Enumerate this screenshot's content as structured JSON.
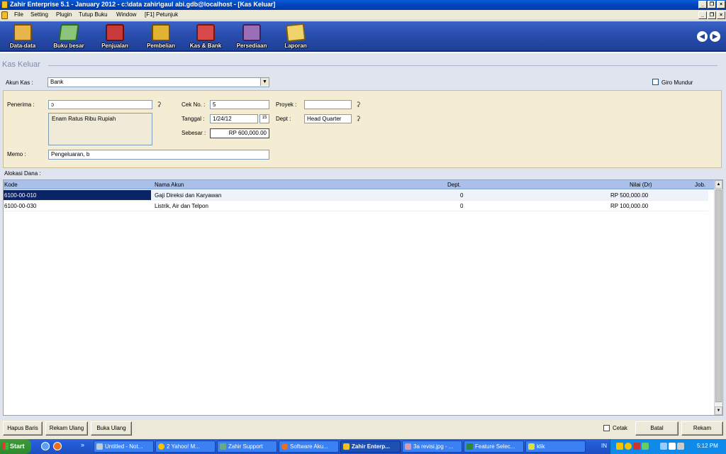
{
  "window": {
    "title": "Zahir Enterprise 5.1 - January 2012 - c:\\data zahir\\gaul abi.gdb@localhost - [Kas Keluar]",
    "controls": [
      "_",
      "ȴ",
      "×"
    ]
  },
  "menu": {
    "items": [
      "File",
      "Setting",
      "Plugin",
      "Tutup Buku",
      "Window",
      "[F1] Petunjuk"
    ]
  },
  "toolbar": {
    "buttons": [
      {
        "label": "Data-data",
        "icon": "data-data-icon",
        "color": "#e8b54a"
      },
      {
        "label": "Buku besar",
        "icon": "ledger-icon",
        "color": "#8bc37a"
      },
      {
        "label": "Penjualan",
        "icon": "sales-icon",
        "color": "#c83a3a"
      },
      {
        "label": "Pembelian",
        "icon": "purchase-icon",
        "color": "#e2b233"
      },
      {
        "label": "Kas & Bank",
        "icon": "cash-bank-icon",
        "color": "#d84a4a"
      },
      {
        "label": "Persediaan",
        "icon": "inventory-icon",
        "color": "#9a6fb8"
      },
      {
        "label": "Laporan",
        "icon": "report-icon",
        "color": "#f0d36a"
      }
    ]
  },
  "form": {
    "heading": "Kas Keluar",
    "akun_kas_label": "Akun Kas :",
    "akun_kas_value": "Bank",
    "giro_mundur_label": "Giro Mundur",
    "penerima_label": "Penerima :",
    "penerima_value": "ɔ",
    "terbilang": "Enam Ratus Ribu Rupiah",
    "cek_no_label": "Cek No. :",
    "cek_no_value": "5",
    "tanggal_label": "Tanggal :",
    "tanggal_value": "1/24/12",
    "calendar_icon_text": "15",
    "sebesar_label": "Sebesar :",
    "sebesar_value": "RP 600,000.00",
    "proyek_label": "Proyek :",
    "proyek_value": "",
    "dept_label": "Dept :",
    "dept_value": "Head Quarter",
    "memo_label": "Memo :",
    "memo_value": "Pengeluaran, b"
  },
  "alokasi": {
    "label": "Alokasi Dana :",
    "columns": [
      "Kode",
      "Nama Akun",
      "Dept.",
      "Nilai (Dr)",
      "Job."
    ],
    "rows": [
      {
        "kode": "6100-00-010",
        "nama": "Gaji Direksi dan Karyawan",
        "dept": "0",
        "nilai": "RP 500,000.00"
      },
      {
        "kode": "6100-00-030",
        "nama": "Listrik, Air dan Telpon",
        "dept": "0",
        "nilai": "RP 100,000.00"
      }
    ]
  },
  "actions": {
    "hapus_baris": "Hapus Baris",
    "rekam_ulang": "Rekam Ulang",
    "buka_ulang": "Buka Ulang",
    "cetak": "Cetak",
    "batal": "Batal",
    "rekam": "Rekam"
  },
  "taskbar": {
    "start": "Start",
    "tasks": [
      "Untitled - Not...",
      "2 Yahoo! M...",
      "Zahir Support",
      "Software Aku...",
      "Zahir Enterp...",
      "3a revisi.jpg - ...",
      "Feature Selec...",
      "klik"
    ],
    "lang": "IN",
    "clock": "5:12 PM"
  }
}
